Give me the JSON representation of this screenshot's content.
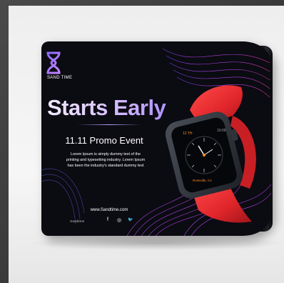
{
  "banner": {
    "brand_name": "SAND TIME",
    "headline": "Starts Early",
    "event_title": "11.11 Promo Event",
    "blurb_lines": [
      "Lorem Ipsum is simply dummy text of the",
      "printing and typesetting industry. Lorem Ipsum",
      "has been the industry's standard dummy text"
    ],
    "website": "www.Sandtime.com",
    "footer_brand": "Sandtime",
    "social": {
      "facebook_glyph": "f",
      "instagram_glyph": "◎",
      "twitter_glyph": "🐦"
    },
    "logo_icon": "hourglass-icon",
    "colors": {
      "background": "#0b0b12",
      "accent_purple": "#b9a0ff",
      "accent_pink": "#ff3d9a",
      "watch_band": "#e1262b"
    }
  },
  "watch": {
    "screen_text_top": "12 TH",
    "screen_time": "10:09",
    "screen_text_bottom": "Roseville, CA"
  }
}
